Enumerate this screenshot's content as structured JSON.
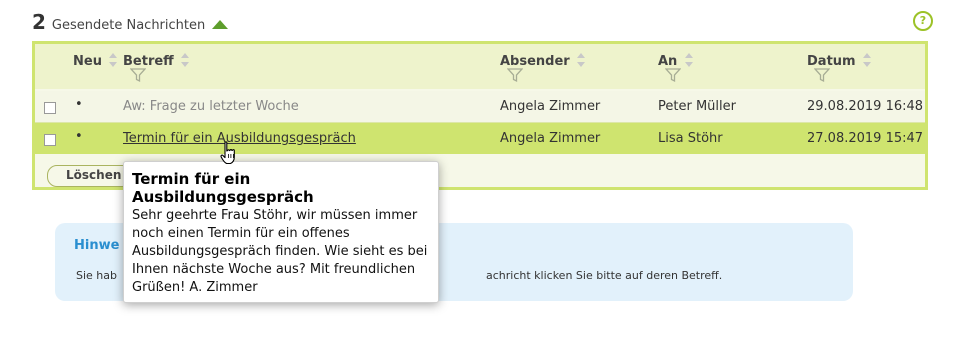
{
  "header": {
    "count": "2",
    "title": "Gesendete Nachrichten",
    "icon": "cloud-up-icon",
    "accent_color": "#5e9e2c"
  },
  "help": {
    "label": "?"
  },
  "table": {
    "columns": {
      "new": "Neu",
      "subject": "Betreff",
      "sender": "Absender",
      "recipient": "An",
      "date": "Datum"
    },
    "rows": [
      {
        "new": "•",
        "subject": "Aw: Frage zu letzter Woche",
        "sender": "Angela Zimmer",
        "recipient": "Peter Müller",
        "date": "29.08.2019 16:48"
      },
      {
        "new": "•",
        "subject": "Termin für ein Ausbildungsgespräch",
        "sender": "Angela Zimmer",
        "recipient": "Lisa Stöhr",
        "date": "27.08.2019 15:47"
      }
    ],
    "delete_label": "Löschen"
  },
  "hint": {
    "title": "Hinwe",
    "text_left": "Sie hab",
    "text_right": "achricht klicken Sie bitte auf deren Betreff."
  },
  "tooltip": {
    "title": "Termin für ein Ausbildungsgespräch",
    "body": "Sehr geehrte Frau Stöhr, wir müssen immer noch einen Termin für ein offenes Ausbildungsgespräch finden. Wie sieht es bei Ihnen nächste Woche aus? Mit freundlichen Grüßen! A. Zimmer"
  },
  "colors": {
    "panel_border": "#cfe46f",
    "selected_row": "#cfe46f",
    "hint_bg": "#e2f1fb",
    "hint_title": "#2a8fd0"
  }
}
